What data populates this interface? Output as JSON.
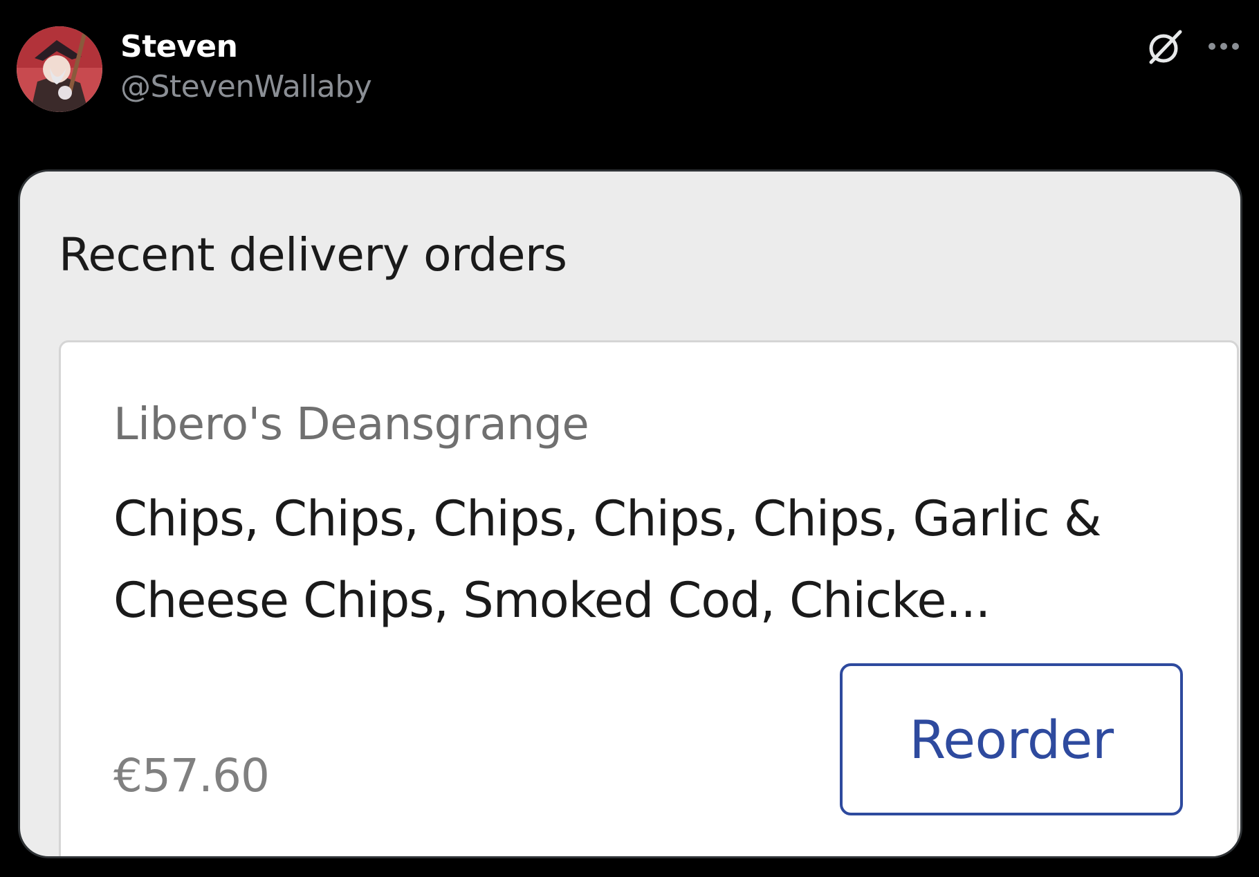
{
  "tweet": {
    "author": {
      "name": "Steven",
      "handle": "@StevenWallaby",
      "avatar": "avatar-image"
    },
    "icons": {
      "grok": "grok-icon",
      "more": "more-options-icon"
    }
  },
  "screenshot": {
    "section_title": "Recent delivery orders",
    "order": {
      "restaurant": "Libero's Deansgrange",
      "items": "Chips, Chips, Chips, Chips, Chips, Garlic & Cheese Chips, Smoked Cod, Chicke...",
      "price": "€57.60",
      "reorder_label": "Reorder"
    },
    "colors": {
      "accent": "#2e4a9e",
      "panel_background": "#ececec",
      "card_background": "#ffffff"
    }
  }
}
